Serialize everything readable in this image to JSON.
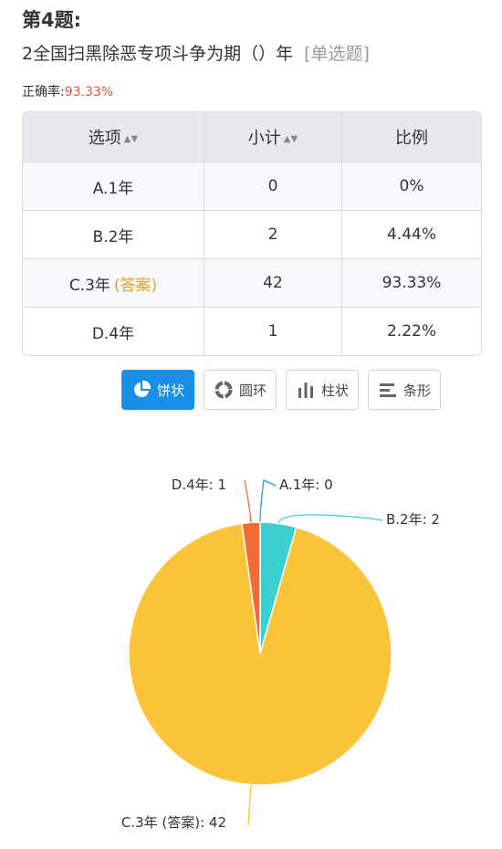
{
  "question": {
    "number": "第4题:",
    "text": "2全国扫黑除恶专项斗争为期（）年",
    "type": "[单选题]",
    "accuracy_label": "正确率:",
    "accuracy_value": "93.33%"
  },
  "table": {
    "headers": [
      "选项",
      "小计",
      "比例"
    ],
    "rows": [
      {
        "option": "A.1年",
        "answer_tag": "",
        "count": "0",
        "ratio": "0%"
      },
      {
        "option": "B.2年",
        "answer_tag": "",
        "count": "2",
        "ratio": "4.44%"
      },
      {
        "option": "C.3年",
        "answer_tag": "(答案)",
        "count": "42",
        "ratio": "93.33%"
      },
      {
        "option": "D.4年",
        "answer_tag": "",
        "count": "1",
        "ratio": "2.22%"
      }
    ]
  },
  "chart_tabs": [
    {
      "label": "饼状",
      "icon": "pie-icon",
      "active": true
    },
    {
      "label": "圆环",
      "icon": "donut-icon",
      "active": false
    },
    {
      "label": "柱状",
      "icon": "bar-icon",
      "active": false
    },
    {
      "label": "条形",
      "icon": "horizontal-bar-icon",
      "active": false
    }
  ],
  "colors": {
    "accent": "#1a8fea",
    "accuracy": "#e9543c",
    "answer": "#f0a028"
  },
  "chart_data": {
    "type": "pie",
    "categories": [
      "A.1年",
      "B.2年",
      "C.3年 (答案)",
      "D.4年"
    ],
    "values": [
      0,
      2,
      42,
      1
    ],
    "labels": [
      "A.1年: 0",
      "B.2年: 2",
      "C.3年 (答案): 42",
      "D.4年: 1"
    ],
    "colors": [
      "#2e9bd9",
      "#3ccfcf",
      "#fcc43a",
      "#f26b35"
    ]
  }
}
